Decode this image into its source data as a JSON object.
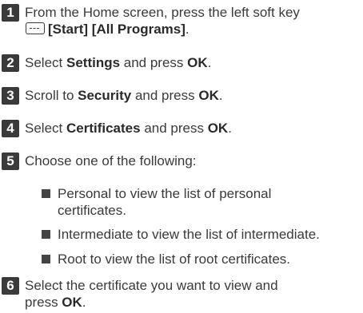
{
  "steps": [
    {
      "number": "1",
      "line1": "From the Home screen, press the left soft key",
      "softkey_icon": "left-soft-key-icon",
      "path": "[Start] [All Programs]",
      "period": "."
    },
    {
      "number": "2",
      "pre": "Select ",
      "bold": "Settings",
      "mid": " and press ",
      "key": "OK",
      "period": "."
    },
    {
      "number": "3",
      "pre": "Scroll to ",
      "bold": "Security",
      "mid": " and press ",
      "key": "OK",
      "period": "."
    },
    {
      "number": "4",
      "pre": "Select ",
      "bold": "Certificates",
      "mid": " and press ",
      "key": "OK",
      "period": "."
    },
    {
      "number": "5",
      "text": "Choose one of the following:",
      "options": [
        {
          "line1": "Personal to view the list of personal",
          "line2": "certificates."
        },
        {
          "line1": "Intermediate to view the list of intermediate."
        },
        {
          "line1": "Root to view the list of root certificates."
        }
      ]
    },
    {
      "number": "6",
      "line1": "Select the certificate you want to view and",
      "pre2": "press ",
      "key": "OK",
      "period": "."
    }
  ]
}
